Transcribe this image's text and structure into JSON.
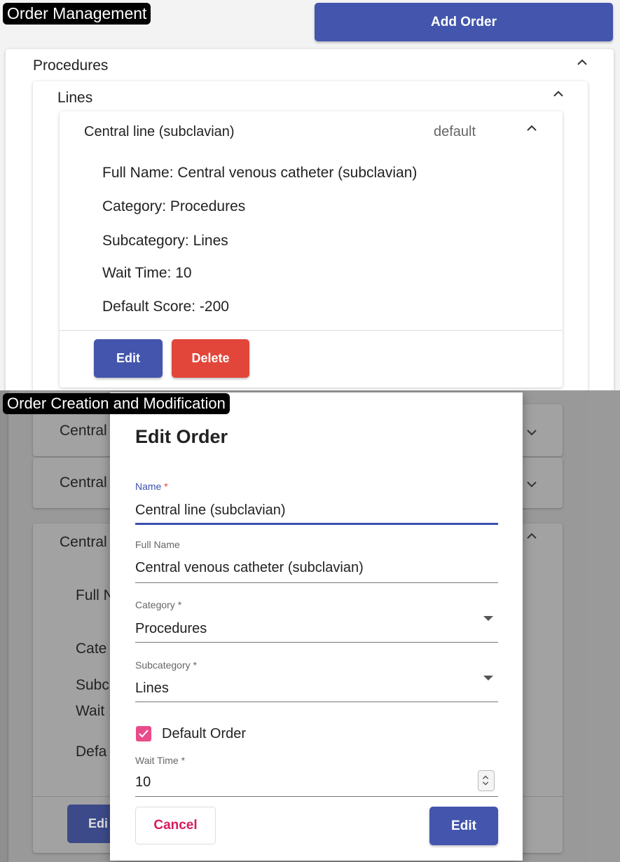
{
  "captions": {
    "top": "Order Management",
    "bottom": "Order Creation and Modification"
  },
  "header": {
    "add_order_label": "Add Order"
  },
  "procedures": {
    "label": "Procedures"
  },
  "lines": {
    "label": "Lines"
  },
  "order_item": {
    "name": "Central line (subclavian)",
    "badge": "default",
    "full_name": "Full Name: Central venous catheter (subclavian)",
    "category": "Category: Procedures",
    "subcategory": "Subcategory: Lines",
    "wait_time": "Wait Time: 10",
    "default_score": "Default Score: -200",
    "edit_label": "Edit",
    "delete_label": "Delete"
  },
  "background_list": {
    "row1": "Central",
    "row2": "Central",
    "row3": "Central",
    "detail_full": "Full N",
    "detail_cat": "Cate",
    "detail_sub": "Subc",
    "detail_wait": "Wait",
    "detail_def": "Defa",
    "edit_partial": "Edi"
  },
  "dialog": {
    "title": "Edit Order",
    "name_label": "Name",
    "required_mark": "*",
    "name_value": "Central line (subclavian)",
    "full_name_label": "Full Name",
    "full_name_value": "Central venous catheter (subclavian)",
    "category_label": "Category *",
    "category_value": "Procedures",
    "subcategory_label": "Subcategory *",
    "subcategory_value": "Lines",
    "default_order_label": "Default Order",
    "default_order_checked": true,
    "wait_time_label": "Wait Time *",
    "wait_time_value": "10",
    "cancel_label": "Cancel",
    "edit_label": "Edit"
  },
  "icons": {
    "expand": "chevron-up-icon",
    "collapse": "chevron-down-icon",
    "select": "dropdown-caret-icon",
    "stepper": "stepper-icon",
    "checkbox": "checkmark-icon"
  },
  "colors": {
    "primary": "#4355ad",
    "danger": "#e2463a",
    "accent_pink": "#e94c8a",
    "cancel_text": "#d81b60"
  }
}
